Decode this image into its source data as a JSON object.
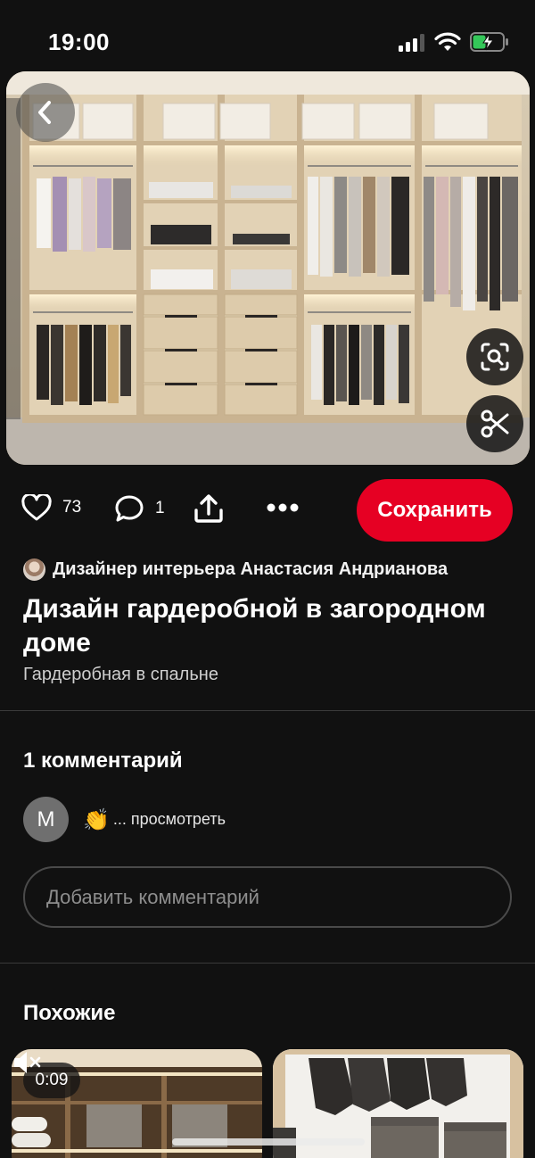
{
  "status_bar": {
    "time": "19:00"
  },
  "pin": {
    "like_count": "73",
    "comment_count": "1",
    "save_label": "Сохранить",
    "author": "Дизайнер интерьера Анастасия Андрианова",
    "title": "Дизайн гардеробной в загородном доме",
    "subtitle": "Гардеробная в спальне"
  },
  "comments": {
    "heading": "1 комментарий",
    "items": [
      {
        "avatar_initial": "M",
        "emoji": "👏",
        "text": "... просмотреть"
      }
    ],
    "input_placeholder": "Добавить комментарий"
  },
  "similar": {
    "heading": "Похожие",
    "cards": [
      {
        "video_duration": "0:09"
      }
    ]
  },
  "colors": {
    "accent": "#e60023",
    "background": "#111111"
  }
}
